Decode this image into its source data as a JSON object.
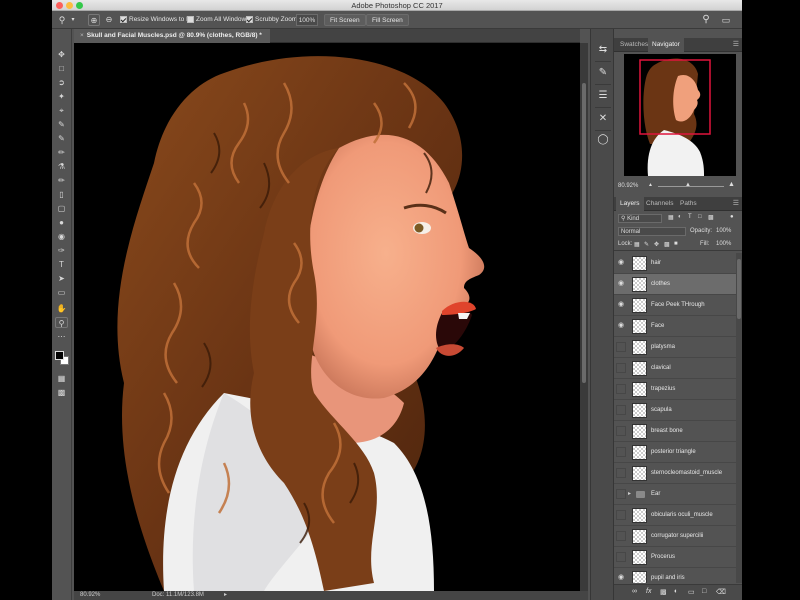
{
  "window": {
    "title": "Adobe Photoshop CC 2017"
  },
  "options": {
    "resize_windows": "Resize Windows to Fit",
    "zoom_all": "Zoom All Windows",
    "scrubby_zoom": "Scrubby Zoom",
    "zoom_value": "100%",
    "fit_screen": "Fit Screen",
    "fill_screen": "Fill Screen"
  },
  "document": {
    "tab_title": "Skull and Facial Muscles.psd @ 80.9% (clothes, RGB/8) *"
  },
  "status": {
    "zoom": "80.92%",
    "doc": "Doc: 11.1M/123.8M"
  },
  "navigator": {
    "tabs": [
      "Swatches",
      "Navigator"
    ],
    "zoom": "80.92%"
  },
  "layers_panel": {
    "tabs": [
      "Layers",
      "Channels",
      "Paths"
    ],
    "kind": "Kind",
    "blend": "Normal",
    "opacity_label": "Opacity:",
    "opacity": "100%",
    "lock_label": "Lock:",
    "fill_label": "Fill:",
    "fill": "100%",
    "layers": [
      {
        "name": "hair",
        "visible": true,
        "selected": false
      },
      {
        "name": "clothes",
        "visible": true,
        "selected": true
      },
      {
        "name": "Face Peek THrough",
        "visible": true,
        "selected": false
      },
      {
        "name": "Face",
        "visible": true,
        "selected": false
      },
      {
        "name": "platysma",
        "visible": false,
        "selected": false
      },
      {
        "name": "clavical",
        "visible": false,
        "selected": false
      },
      {
        "name": "trapezius",
        "visible": false,
        "selected": false
      },
      {
        "name": "scapula",
        "visible": false,
        "selected": false
      },
      {
        "name": "breast bone",
        "visible": false,
        "selected": false
      },
      {
        "name": "posterior triangle",
        "visible": false,
        "selected": false
      },
      {
        "name": "sternocleomastoid_muscle",
        "visible": false,
        "selected": false
      },
      {
        "name": "Ear",
        "visible": false,
        "selected": false,
        "group": true
      },
      {
        "name": "obicularis oculi_muscle",
        "visible": false,
        "selected": false
      },
      {
        "name": "corrugator supercilii",
        "visible": false,
        "selected": false
      },
      {
        "name": "Procerus",
        "visible": false,
        "selected": false
      },
      {
        "name": "pupil and iris",
        "visible": true,
        "selected": false
      }
    ]
  },
  "colors": {
    "app_bg": "#535353",
    "canvas_bg": "#000000",
    "selected_row": "#6c6c6c",
    "nav_frame": "#e0143c",
    "hair": "#6b3514",
    "skin": "#f2a27c",
    "lips": "#e0442c",
    "shirt": "#f2f2f2"
  }
}
